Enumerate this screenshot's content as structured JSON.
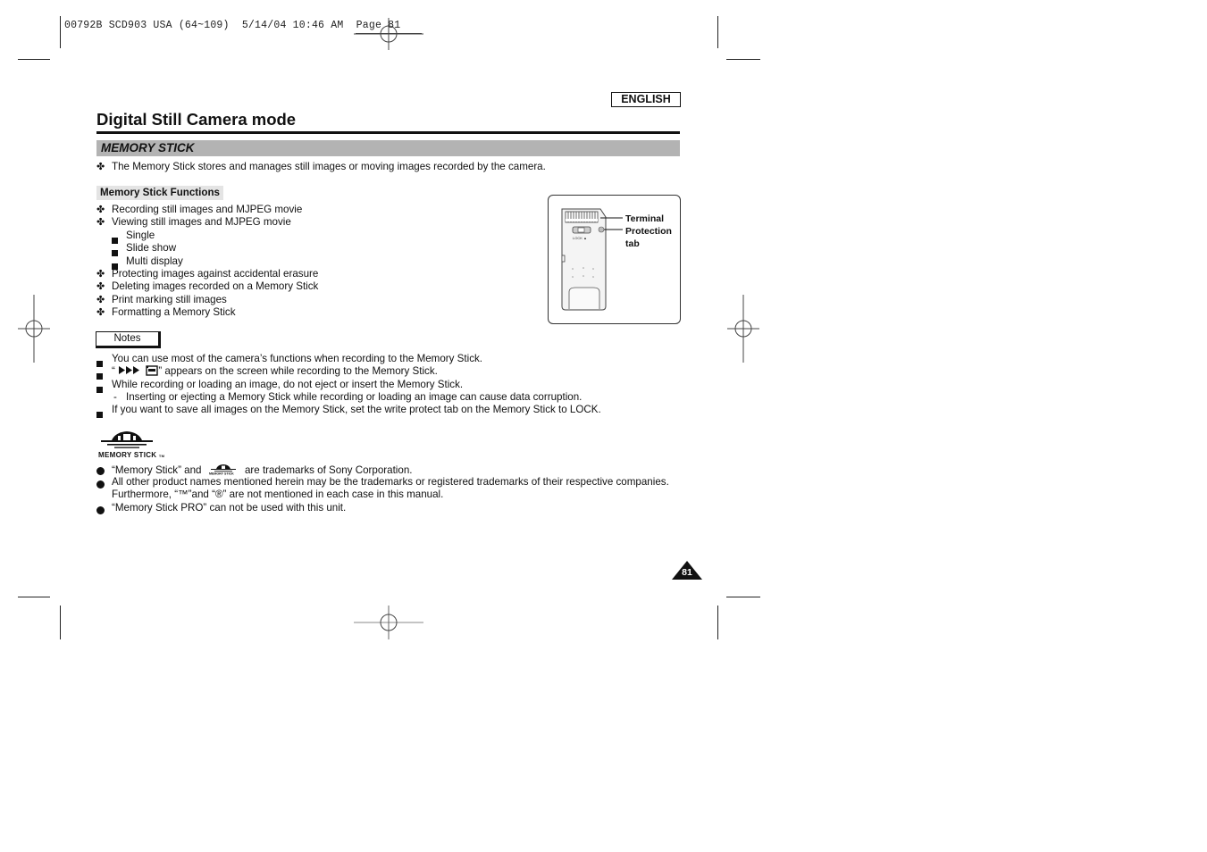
{
  "print_slug": {
    "text": "00792B SCD903 USA (64~109)  5/14/04 10:46 AM  Page 81"
  },
  "header": {
    "language_badge": "ENGLISH",
    "page_title": "Digital Still Camera mode"
  },
  "section": {
    "title": "MEMORY STICK",
    "intro_bullet_icon": "cross-bullet-icon",
    "intro": "The Memory Stick stores and manages still images or moving images recorded by the camera."
  },
  "functions": {
    "heading": "Memory Stick Functions",
    "items": [
      {
        "text": "Recording still images and MJPEG movie",
        "level": 1
      },
      {
        "text": "Viewing still images and MJPEG movie",
        "level": 1
      },
      {
        "text": "Single",
        "level": 2
      },
      {
        "text": "Slide show",
        "level": 2
      },
      {
        "text": "Multi display",
        "level": 2
      },
      {
        "text": "Protecting images against accidental erasure",
        "level": 1
      },
      {
        "text": "Deleting images recorded on a Memory Stick",
        "level": 1
      },
      {
        "text": "Print marking still images",
        "level": 1
      },
      {
        "text": "Formatting a Memory Stick",
        "level": 1
      }
    ]
  },
  "figure": {
    "labels": [
      "Terminal",
      "Protection",
      "tab"
    ],
    "lock_text": "LOCK"
  },
  "notes": {
    "label": "Notes",
    "items": [
      {
        "text": "You can use most of the camera’s functions when recording to the Memory Stick.",
        "type": "square"
      },
      {
        "text_before": "“",
        "icons": [
          "triple-play-arrow-icon",
          "memory-stick-icon"
        ],
        "text_after": "” appears on the screen while recording to the Memory Stick.",
        "type": "square"
      },
      {
        "text": "While recording or loading an image, do not eject or insert the Memory Stick.",
        "type": "square"
      },
      {
        "text": "Inserting or ejecting a Memory Stick while recording or loading an image can cause data corruption.",
        "type": "dash",
        "dash": "-"
      },
      {
        "text": "If you want to save all images on the Memory Stick, set the write protect tab on the Memory Stick to LOCK.",
        "type": "square"
      }
    ]
  },
  "trademarks": {
    "logo_text": "Memory Stick",
    "logo_tm": "TM",
    "items": [
      {
        "text_before": "“Memory Stick” and",
        "text_after": "are trademarks of Sony Corporation."
      },
      {
        "line1": "All other product names mentioned herein may be the trademarks or registered trademarks of their respective companies.",
        "line2": "Furthermore, “™”and “®” are not mentioned in each case in this manual."
      },
      {
        "text": "“Memory Stick PRO” can not be used with this unit."
      }
    ]
  },
  "page_number": "81"
}
